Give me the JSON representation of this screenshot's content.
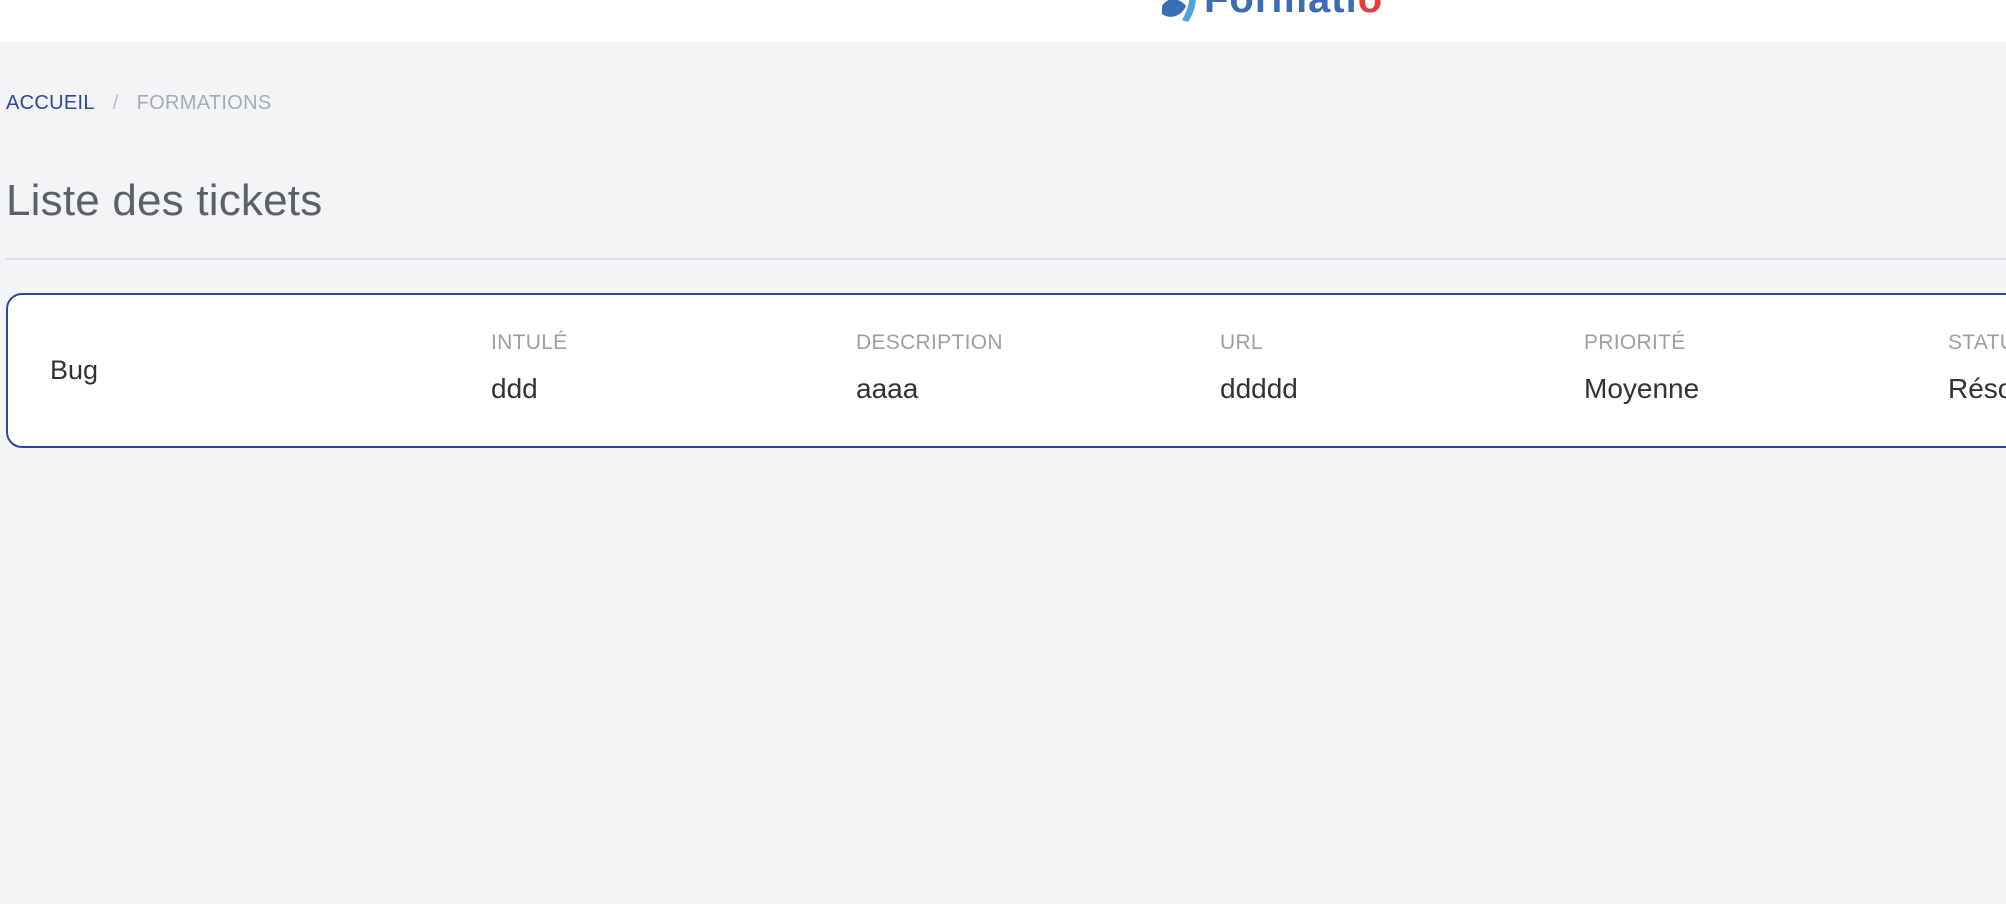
{
  "header": {
    "logo_text": "Formatio",
    "logo_text_main": "Formati",
    "logo_text_accent": "o",
    "brand_color": "#3a6db5",
    "accent_color": "#e23b3b"
  },
  "breadcrumb": {
    "home": "ACCUEIL",
    "separator": "/",
    "current": "FORMATIONS"
  },
  "page": {
    "title": "Liste des tickets"
  },
  "tickets": [
    {
      "type": "Bug",
      "fields": [
        {
          "label": "INTULÉ",
          "value": "ddd"
        },
        {
          "label": "DESCRIPTION",
          "value": "aaaa"
        },
        {
          "label": "URL",
          "value": "ddddd"
        },
        {
          "label": "PRIORITÉ",
          "value": "Moyenne"
        },
        {
          "label": "STATUT",
          "value": "Résolu"
        }
      ]
    }
  ],
  "colors": {
    "background": "#f3f4f6",
    "link": "#2a4a9a",
    "card_border": "#2a4a9a"
  }
}
